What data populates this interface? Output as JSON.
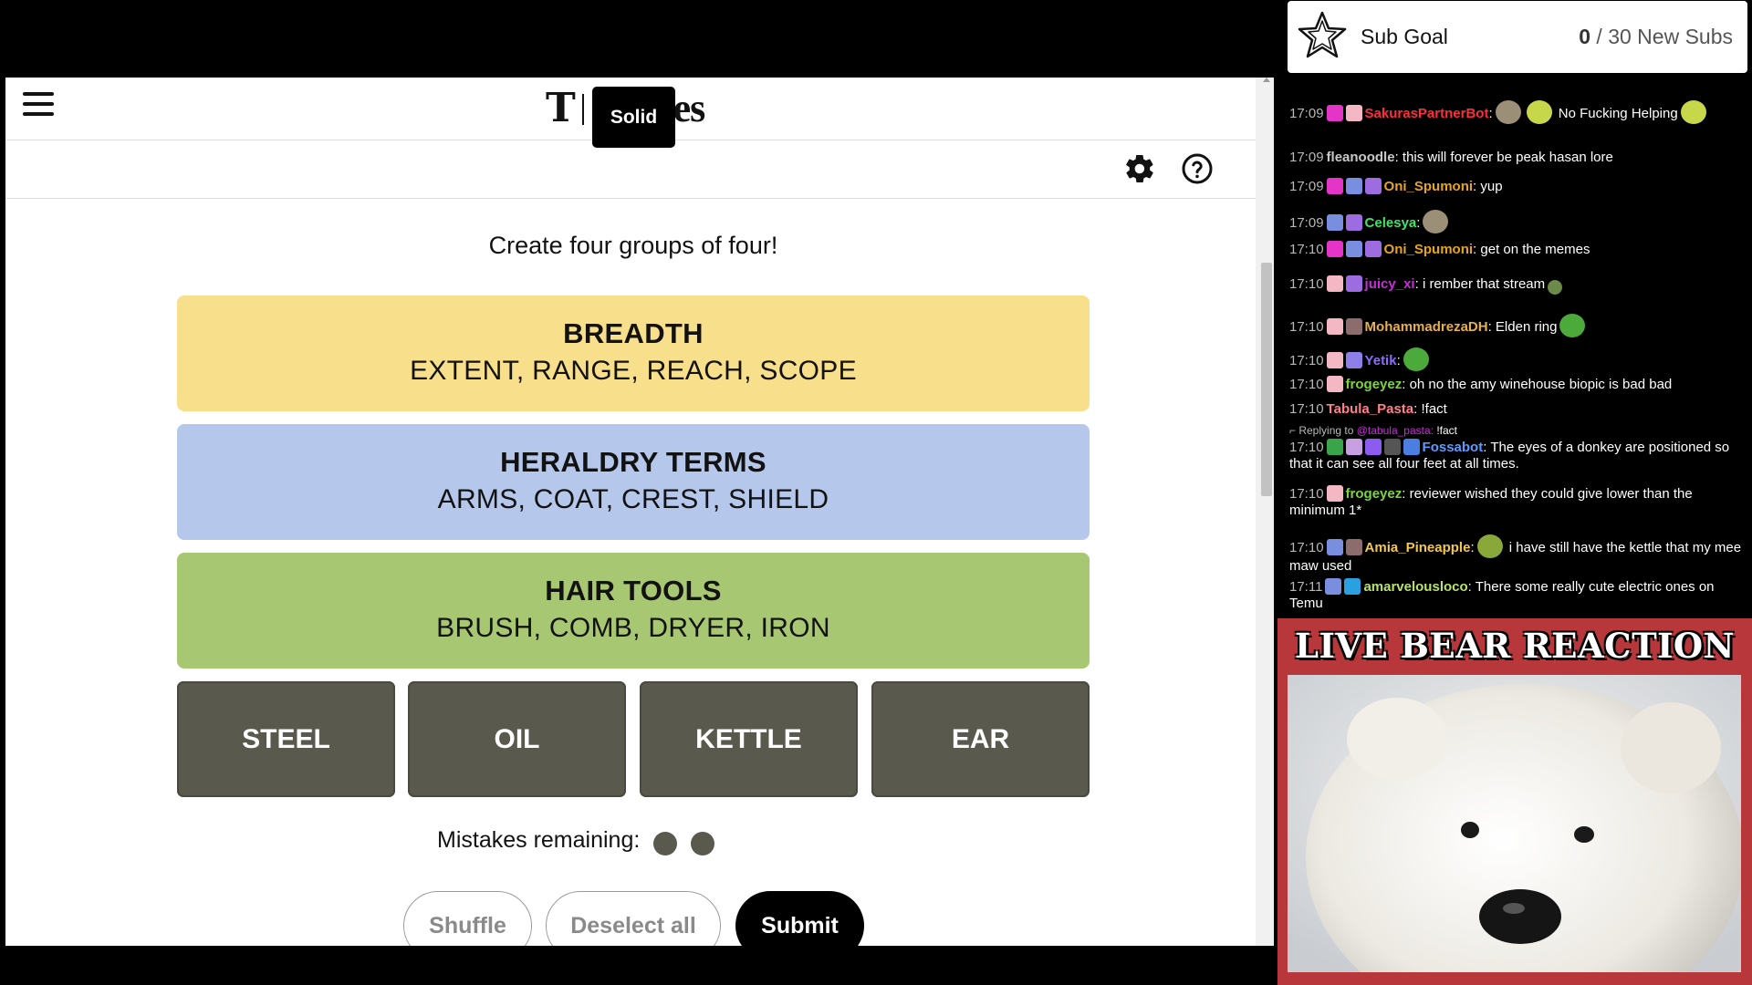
{
  "game": {
    "logo": "Games",
    "logo_t": "T",
    "tooltip": "Solid",
    "instructions": "Create four groups of four!",
    "solved_groups": [
      {
        "name": "BREADTH",
        "words": "EXTENT, RANGE, REACH, SCOPE",
        "color": "#f8df8b"
      },
      {
        "name": "HERALDRY TERMS",
        "words": "ARMS, COAT, CREST, SHIELD",
        "color": "#b5c8eb"
      },
      {
        "name": "HAIR TOOLS",
        "words": "BRUSH, COMB, DRYER, IRON",
        "color": "#a8c772"
      }
    ],
    "tiles": [
      "STEEL",
      "OIL",
      "KETTLE",
      "EAR"
    ],
    "mistakes_label": "Mistakes remaining:",
    "mistakes_remaining": 2,
    "buttons": {
      "shuffle": "Shuffle",
      "deselect": "Deselect all",
      "submit": "Submit"
    }
  },
  "sub_goal": {
    "label": "Sub Goal",
    "current": "0",
    "rest": " / 30 New Subs"
  },
  "chat": {
    "messages": [
      {
        "time": "17:09",
        "user": "SakurasPartnerBot",
        "color": "#ff2d3c",
        "text": "No Fucking Helping"
      },
      {
        "time": "17:09",
        "user": "fleanoodle",
        "color": "#c8c8c8",
        "text": "this will forever be peak hasan lore"
      },
      {
        "time": "17:09",
        "user": "Oni_Spumoni",
        "color": "#e7a51c",
        "text": "yup"
      },
      {
        "time": "17:09",
        "user": "Celesya",
        "color": "#3fe26b",
        "text": ""
      },
      {
        "time": "17:10",
        "user": "Oni_Spumoni",
        "color": "#e7a51c",
        "text": "get on the memes"
      },
      {
        "time": "17:10",
        "user": "juicy_xi",
        "color": "#c62fd6",
        "text": "i rember that stream"
      },
      {
        "time": "17:10",
        "user": "MohammadrezaDH",
        "color": "#e8b04a",
        "text": "Elden ring"
      },
      {
        "time": "17:10",
        "user": "Yetik",
        "color": "#8e6cff",
        "text": ""
      },
      {
        "time": "17:10",
        "user": "frogeyez",
        "color": "#7ad63c",
        "text": "oh no the amy winehouse biopic is bad bad"
      },
      {
        "time": "17:10",
        "user": "Tabula_Pasta",
        "color": "#ff7f8a",
        "text": "!fact"
      },
      {
        "time": "17:10",
        "user": "Fossabot",
        "color": "#5b9bff",
        "text": "The eyes of a donkey are positioned so that it can see all four feet at all times."
      },
      {
        "time": "17:10",
        "user": "frogeyez",
        "color": "#7ad63c",
        "text": "reviewer wished they could give lower than the minimum 1*"
      },
      {
        "time": "17:10",
        "user": "Amia_Pineapple",
        "color": "#f2c94c",
        "text": "i have still have the kettle that my mee maw used"
      },
      {
        "time": "17:11",
        "user": "amarvelousloco",
        "color": "#b6e36a",
        "text": "There some really cute electric ones on Temu"
      }
    ],
    "reply": {
      "prefix": "Replying to",
      "mention": "@tabula_pasta:",
      "text": "!fact"
    }
  },
  "bear": {
    "title": "LIVE BEAR REACTION"
  }
}
